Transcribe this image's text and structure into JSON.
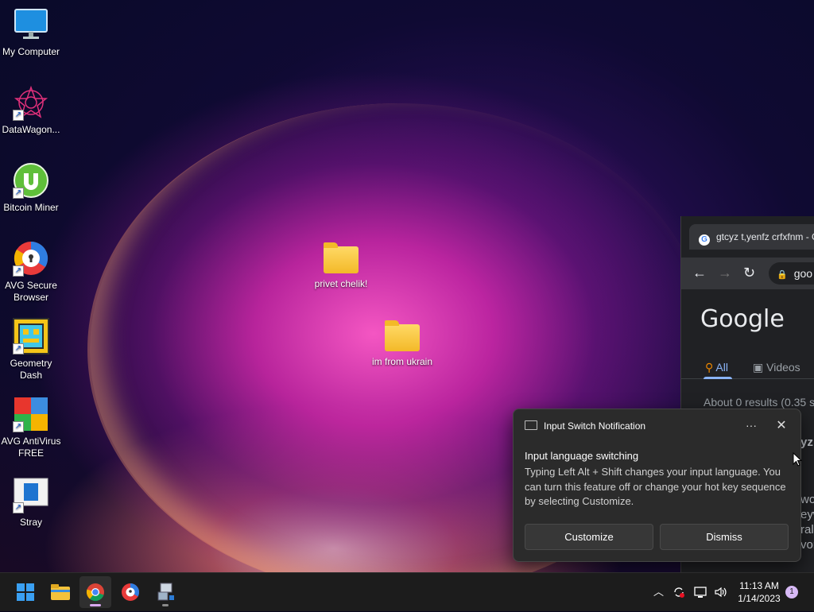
{
  "desktop": {
    "icons": [
      {
        "label": "My Computer",
        "icon": "monitor-icon"
      },
      {
        "label": "DataWagon...",
        "icon": "datawagon-icon"
      },
      {
        "label": "Bitcoin Miner",
        "icon": "utorrent-icon"
      },
      {
        "label": "AVG Secure Browser",
        "icon": "avg-browser-icon"
      },
      {
        "label": "Geometry Dash",
        "icon": "geometry-dash-icon"
      },
      {
        "label": "AVG AntiVirus FREE",
        "icon": "avg-antivirus-icon"
      },
      {
        "label": "Stray",
        "icon": "stray-icon"
      }
    ],
    "folders": [
      {
        "label": "privet chelik!"
      },
      {
        "label": "im from ukrain"
      }
    ]
  },
  "browser": {
    "tab_title": "gtcyz t,yenfz crfxfnm - G",
    "address": "goo",
    "logo": "Google",
    "tabs": {
      "all": "All",
      "videos": "Videos"
    },
    "stats": "About 0 results (0.35 s",
    "fragments": [
      "yz",
      "wo",
      "eyw",
      "ral",
      "vor"
    ]
  },
  "notification": {
    "app": "Input Switch Notification",
    "title": "Input language switching",
    "body": "Typing Left Alt + Shift changes your input language. You can turn this feature off or change your hot key sequence by selecting Customize.",
    "buttons": {
      "customize": "Customize",
      "dismiss": "Dismiss"
    }
  },
  "taskbar": {
    "apps": [
      "windows-start-icon",
      "file-explorer-icon",
      "chrome-icon",
      "avg-browser-icon",
      "network-setup-icon"
    ],
    "time": "11:13 AM",
    "date": "1/14/2023",
    "badge": "1"
  },
  "colors": {
    "accent": "#d7b9f5",
    "taskbar": "#1c1c1c",
    "toast": "#2b2b2b"
  }
}
